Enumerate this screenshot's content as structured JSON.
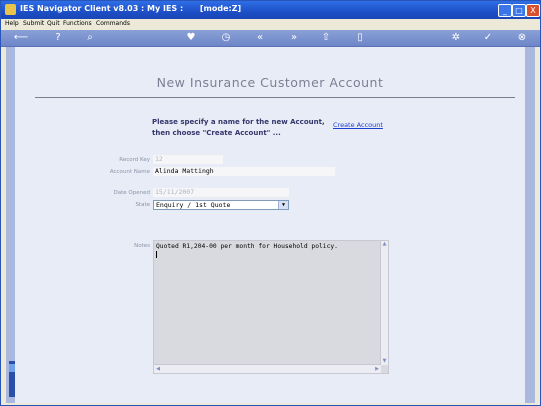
{
  "window": {
    "title": "IES Navigator Client v8.03 : My IES :      [mode:Z]"
  },
  "titlebar": {
    "min": "_",
    "max": "□",
    "close": "X"
  },
  "menu": {
    "items": [
      "Help",
      "Submit",
      "Quit",
      "Functions",
      "Commands"
    ]
  },
  "toolbar": {
    "icons": [
      "back-icon",
      "help-icon",
      "search-icon",
      "favorite-icon",
      "clock-icon",
      "rewind-icon",
      "forward-icon",
      "upload-icon",
      "document-icon",
      "settings-icon",
      "check-icon",
      "close-icon"
    ]
  },
  "page": {
    "heading": "New Insurance Customer Account",
    "instruction_line1": "Please specify a name for the new Account,",
    "instruction_line2": "then choose \"Create Account\" ...",
    "create_link": "Create Account"
  },
  "form": {
    "record_key_label": "Record Key",
    "record_key_value": "12",
    "account_name_label": "Account Name",
    "account_name_value": "Alinda Mattingh",
    "date_opened_label": "Date Opened",
    "date_opened_value": "15/11/2007",
    "state_label": "State",
    "state_value": "Enquiry / 1st Quote",
    "notes_label": "Notes",
    "notes_value": "Quoted R1,204-00 per month for Household policy."
  }
}
